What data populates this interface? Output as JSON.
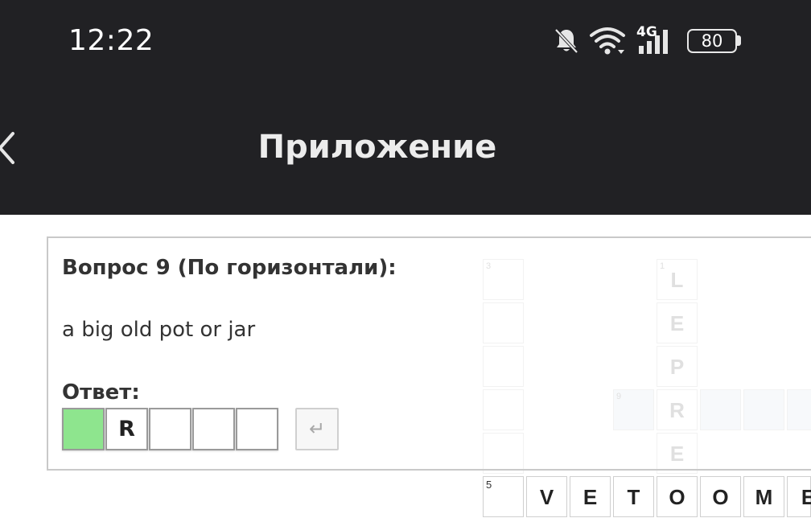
{
  "status_bar": {
    "time": "12:22",
    "network": "4G",
    "battery": "80",
    "icons": [
      "bell-muted-icon",
      "wifi-icon",
      "signal-icon",
      "battery-icon"
    ]
  },
  "header": {
    "title": "Приложение",
    "back_icon": "chevron-left-icon"
  },
  "question": {
    "label": "Вопрос 9 (По горизонтали):",
    "text": "a big old pot or jar",
    "answer_label": "Ответ:",
    "answer_cells": [
      "",
      "R",
      "",
      "",
      ""
    ],
    "enter_icon": "↵"
  },
  "crossword": {
    "numbers": [
      "3",
      "1",
      "9",
      "5"
    ],
    "column_letters": [
      "L",
      "E",
      "P",
      "R",
      "E"
    ],
    "bottom_row": [
      "V",
      "E",
      "T",
      "O",
      "O",
      "M",
      "E"
    ]
  },
  "colors": {
    "header_bg": "#212124",
    "active_cell": "#8ee58e",
    "panel_border": "#c9c9c9"
  }
}
